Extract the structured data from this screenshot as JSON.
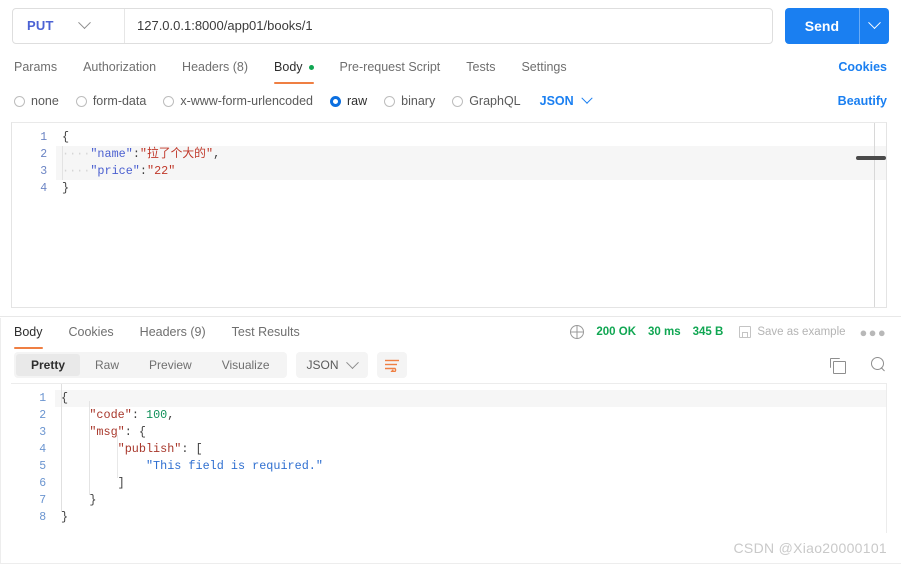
{
  "request": {
    "method": "PUT",
    "method_chevron_icon": "chevron-down-icon",
    "url": "127.0.0.1:8000/app01/books/1",
    "url_placeholder": "Enter request URL",
    "send_label": "Send",
    "send_chevron_icon": "chevron-down-icon",
    "tabs": [
      {
        "label": "Params",
        "active": false
      },
      {
        "label": "Authorization",
        "active": false
      },
      {
        "label": "Headers (8)",
        "active": false
      },
      {
        "label": "Body",
        "active": true,
        "dot": true
      },
      {
        "label": "Pre-request Script",
        "active": false
      },
      {
        "label": "Tests",
        "active": false
      },
      {
        "label": "Settings",
        "active": false
      }
    ],
    "cookies_label": "Cookies",
    "body_types": [
      {
        "label": "none",
        "selected": false
      },
      {
        "label": "form-data",
        "selected": false
      },
      {
        "label": "x-www-form-urlencoded",
        "selected": false
      },
      {
        "label": "raw",
        "selected": true
      },
      {
        "label": "binary",
        "selected": false
      },
      {
        "label": "GraphQL",
        "selected": false
      }
    ],
    "format_label": "JSON",
    "format_chevron_icon": "chevron-down-icon",
    "beautify_label": "Beautify",
    "body_lines": [
      {
        "n": "1",
        "text": "{"
      },
      {
        "n": "2",
        "text": "····\"name\":\"拉了个大的\","
      },
      {
        "n": "3",
        "text": "····\"price\":\"22\""
      },
      {
        "n": "4",
        "text": "}"
      }
    ]
  },
  "response": {
    "tabs": [
      {
        "label": "Body",
        "active": true
      },
      {
        "label": "Cookies",
        "active": false
      },
      {
        "label": "Headers (9)",
        "active": false
      },
      {
        "label": "Test Results",
        "active": false
      }
    ],
    "headers_count_color": "#10a652",
    "globe_icon": "globe-icon",
    "status_code": "200 OK",
    "time": "30 ms",
    "size": "345 B",
    "status_color": "#10a652",
    "save_icon": "floppy-disk-icon",
    "save_as_example_label": "Save as example",
    "more_icon": "ellipsis-icon",
    "view_modes": [
      {
        "label": "Pretty",
        "active": true
      },
      {
        "label": "Raw",
        "active": false
      },
      {
        "label": "Preview",
        "active": false
      },
      {
        "label": "Visualize",
        "active": false
      }
    ],
    "format_label": "JSON",
    "format_chevron_icon": "chevron-down-icon",
    "wrap_icon": "wrap-text-icon",
    "copy_icon": "copy-icon",
    "search_icon": "search-icon",
    "accent_color": "#ef7f43",
    "body_lines": [
      {
        "n": "1",
        "text": "{"
      },
      {
        "n": "2",
        "text": "    \"code\": 100,"
      },
      {
        "n": "3",
        "text": "    \"msg\": {"
      },
      {
        "n": "4",
        "text": "        \"publish\": ["
      },
      {
        "n": "5",
        "text": "            \"This field is required.\""
      },
      {
        "n": "6",
        "text": "        ]"
      },
      {
        "n": "7",
        "text": "    }"
      },
      {
        "n": "8",
        "text": "}"
      }
    ],
    "body_json": {
      "code": 100,
      "msg": {
        "publish": [
          "This field is required."
        ]
      }
    }
  },
  "watermark": "CSDN @Xiao20000101",
  "theme": {
    "primary_blue": "#1a7ff1",
    "method_color": "#4b62d4",
    "accent_orange": "#ef7f43",
    "success_green": "#10a652"
  }
}
